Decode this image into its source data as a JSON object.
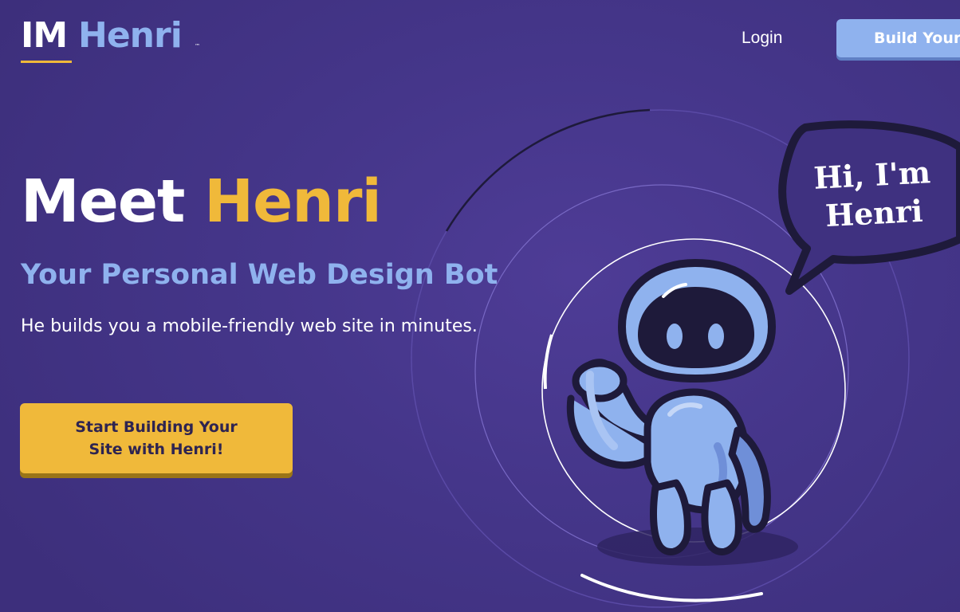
{
  "header": {
    "logo_part1": "IM",
    "logo_part2": "Henri",
    "logo_trademark": "™",
    "login_label": "Login",
    "build_button_label": "Build Your Site"
  },
  "hero": {
    "title_part1": "Meet ",
    "title_part2": "Henri",
    "subtitle": "Your Personal Web Design Bot",
    "description": "He builds you a mobile-friendly web site in minutes.",
    "cta_line1": "Start Building Your",
    "cta_line2": "Site with Henri!"
  },
  "speech_bubble": {
    "line1": "Hi, I'm",
    "line2": "Henri"
  },
  "icons": {
    "robot": "robot-mascot-icon",
    "bubble": "speech-bubble-icon"
  },
  "colors": {
    "background": "#45368a",
    "accent_yellow": "#f0b93a",
    "accent_blue": "#8fb2ee",
    "dark_outline": "#1e1a3a"
  }
}
